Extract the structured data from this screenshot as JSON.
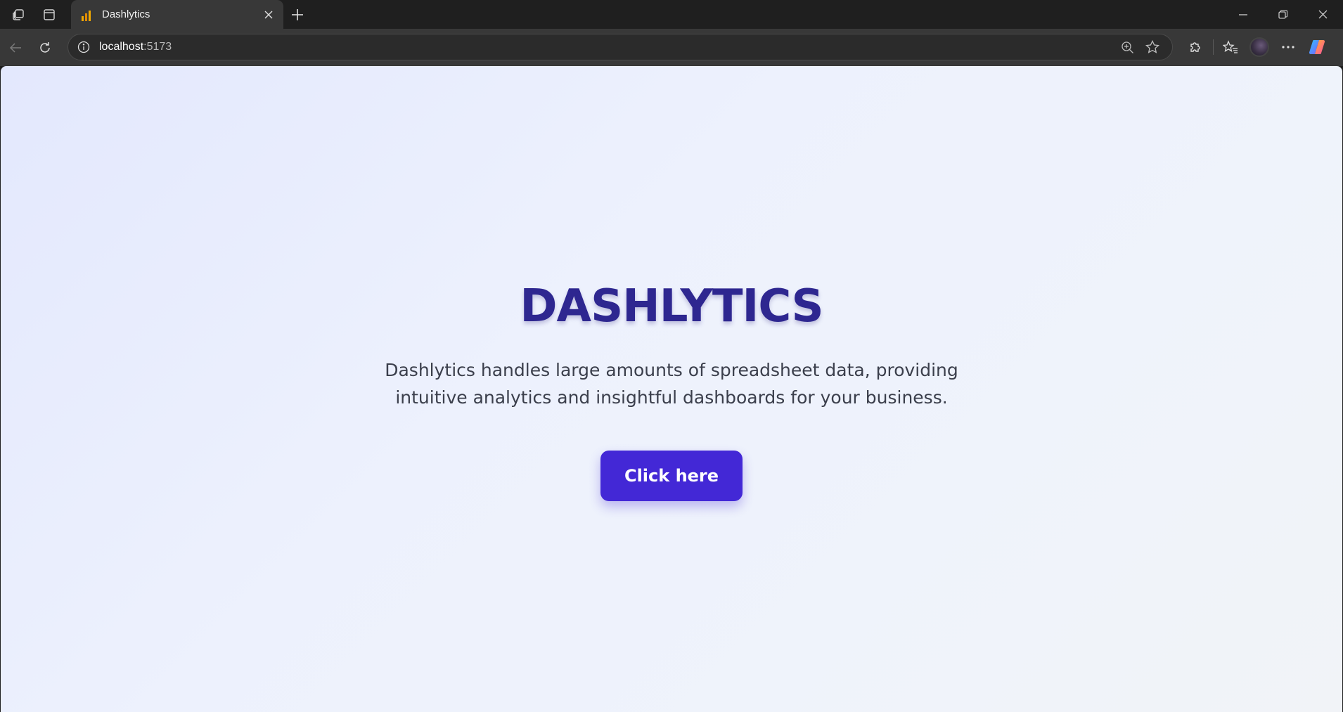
{
  "browser": {
    "tab": {
      "title": "Dashlytics",
      "favicon": "bar-chart-icon"
    },
    "address": {
      "host": "localhost",
      "port": ":5173"
    },
    "icons": {
      "workspaces": "workspaces-icon",
      "tab_actions": "tab-actions-icon",
      "new_tab": "plus-icon",
      "back": "back-arrow-icon",
      "reload": "reload-icon",
      "site_info": "info-icon",
      "zoom": "zoom-icon",
      "favorite": "star-icon",
      "extensions": "puzzle-icon",
      "favorites": "favorites-icon",
      "profile": "avatar",
      "more": "more-icon",
      "copilot": "copilot-icon"
    },
    "accent_colors": {
      "favicon": "#f2a900",
      "copilot": "#7a5cff"
    }
  },
  "page": {
    "hero": {
      "title": "DASHLYTICS",
      "description": "Dashlytics handles large amounts of spreadsheet data, providing intuitive analytics and insightful dashboards for your business.",
      "cta_label": "Click here"
    },
    "colors": {
      "title": "#2e2790",
      "button": "#4328d6",
      "background": "#edf1fd"
    }
  }
}
